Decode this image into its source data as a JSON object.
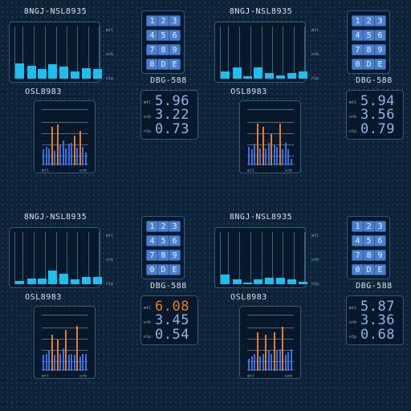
{
  "labels": {
    "ax_top": "mtl",
    "ax_mid": "orb",
    "ax_bot": "nlp"
  },
  "colors": {
    "accent_cyan": "#19c1f0",
    "bar_blue": "#3a6fe2",
    "bar_orange": "#e8792e",
    "alert_orange": "#f07a2a",
    "readout_blue": "#8fb4e8"
  },
  "keypad": [
    "1",
    "2",
    "3",
    "4",
    "5",
    "6",
    "7",
    "8",
    "9",
    "0",
    "D",
    "E"
  ],
  "widgets": [
    {
      "top_title": "8NGJ-NSL8935",
      "mid_title": "OSL8983",
      "dbg_title": "DBG-588",
      "readouts": [
        "5.96",
        "3.22",
        "0.73"
      ],
      "alert_row": -1,
      "hbar_levels": [
        0.3,
        0.25,
        0.18,
        0.28,
        0.24,
        0.14,
        0.21,
        0.18
      ],
      "vbars": [
        [
          0.28,
          "b"
        ],
        [
          0.33,
          "b"
        ],
        [
          0.3,
          "b"
        ],
        [
          0.68,
          "o"
        ],
        [
          0.25,
          "b"
        ],
        [
          0.73,
          "o"
        ],
        [
          0.36,
          "b"
        ],
        [
          0.44,
          "b"
        ],
        [
          0.3,
          "b"
        ],
        [
          0.38,
          "b"
        ],
        [
          0.4,
          "b"
        ],
        [
          0.53,
          "o"
        ],
        [
          0.31,
          "b"
        ],
        [
          0.61,
          "o"
        ],
        [
          0.33,
          "b"
        ],
        [
          0.23,
          "b"
        ]
      ]
    },
    {
      "top_title": "8NGJ-NSL8935",
      "mid_title": "OSL8983",
      "dbg_title": "DBG-588",
      "readouts": [
        "5.94",
        "3.56",
        "0.79"
      ],
      "alert_row": -1,
      "hbar_levels": [
        0.14,
        0.22,
        0.05,
        0.22,
        0.11,
        0.07,
        0.11,
        0.14
      ],
      "vbars": [
        [
          0.33,
          "b"
        ],
        [
          0.28,
          "b"
        ],
        [
          0.38,
          "b"
        ],
        [
          0.74,
          "o"
        ],
        [
          0.3,
          "b"
        ],
        [
          0.68,
          "o"
        ],
        [
          0.3,
          "b"
        ],
        [
          0.4,
          "b"
        ],
        [
          0.55,
          "o"
        ],
        [
          0.36,
          "b"
        ],
        [
          0.33,
          "b"
        ],
        [
          0.74,
          "o"
        ],
        [
          0.28,
          "b"
        ],
        [
          0.4,
          "b"
        ],
        [
          0.28,
          "b"
        ],
        [
          0.12,
          "b"
        ]
      ]
    },
    {
      "top_title": "8NGJ-NSL8935",
      "mid_title": "OSL8983",
      "dbg_title": "DBG-588",
      "readouts": [
        "6.08",
        "3.45",
        "0.54"
      ],
      "alert_row": 0,
      "hbar_levels": [
        0.07,
        0.11,
        0.11,
        0.26,
        0.2,
        0.1,
        0.14,
        0.14
      ],
      "vbars": [
        [
          0.28,
          "b"
        ],
        [
          0.3,
          "b"
        ],
        [
          0.35,
          "b"
        ],
        [
          0.64,
          "o"
        ],
        [
          0.28,
          "b"
        ],
        [
          0.55,
          "o"
        ],
        [
          0.3,
          "b"
        ],
        [
          0.4,
          "b"
        ],
        [
          0.73,
          "o"
        ],
        [
          0.28,
          "b"
        ],
        [
          0.3,
          "b"
        ],
        [
          0.28,
          "b"
        ],
        [
          0.8,
          "o"
        ],
        [
          0.25,
          "b"
        ],
        [
          0.3,
          "b"
        ],
        [
          0.3,
          "b"
        ]
      ]
    },
    {
      "top_title": "8NGJ-NSL8935",
      "mid_title": "OSL8983",
      "dbg_title": "DBG-588",
      "readouts": [
        "5.87",
        "3.36",
        "0.68"
      ],
      "alert_row": -1,
      "hbar_levels": [
        0.18,
        0.1,
        0.03,
        0.1,
        0.13,
        0.13,
        0.1,
        0.05
      ],
      "vbars": [
        [
          0.22,
          "b"
        ],
        [
          0.25,
          "b"
        ],
        [
          0.3,
          "b"
        ],
        [
          0.68,
          "o"
        ],
        [
          0.25,
          "b"
        ],
        [
          0.3,
          "b"
        ],
        [
          0.64,
          "o"
        ],
        [
          0.35,
          "b"
        ],
        [
          0.3,
          "b"
        ],
        [
          0.68,
          "o"
        ],
        [
          0.36,
          "b"
        ],
        [
          0.38,
          "b"
        ],
        [
          0.78,
          "o"
        ],
        [
          0.28,
          "b"
        ],
        [
          0.33,
          "b"
        ],
        [
          0.38,
          "b"
        ]
      ]
    }
  ]
}
